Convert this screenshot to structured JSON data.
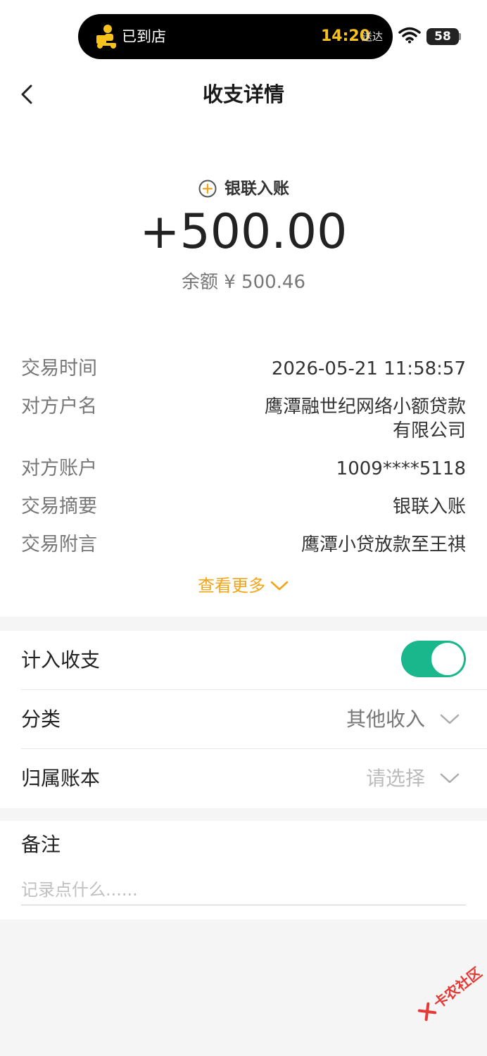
{
  "status_bar": {
    "island_text": "已到店",
    "island_time": "14:20",
    "island_deliver": "送达",
    "battery": "58"
  },
  "nav": {
    "title": "收支详情"
  },
  "hero": {
    "type_label": "银联入账",
    "amount": "+500.00",
    "balance": "余额 ¥ 500.46"
  },
  "details": [
    {
      "label": "交易时间",
      "value": "2026-05-21 11:58:57"
    },
    {
      "label": "对方户名",
      "value_line1": "鹰潭融世纪网络小额贷款",
      "value_line2": "有限公司"
    },
    {
      "label": "对方账户",
      "value": "1009****5118"
    },
    {
      "label": "交易摘要",
      "value": "银联入账"
    },
    {
      "label": "交易附言",
      "value": "鹰潭小贷放款至王祺"
    }
  ],
  "more_label": "查看更多",
  "settings": {
    "include_label": "计入收支",
    "include_on": true,
    "category_label": "分类",
    "category_value": "其他收入",
    "book_label": "归属账本",
    "book_value": "请选择"
  },
  "note": {
    "label": "备注",
    "placeholder": "记录点什么......",
    "value": ""
  },
  "watermark": "卡农社区",
  "colors": {
    "accent": "#f2a51a",
    "toggle_on": "#1bb78c",
    "island_time": "#f7c21a",
    "watermark": "#e53935"
  }
}
